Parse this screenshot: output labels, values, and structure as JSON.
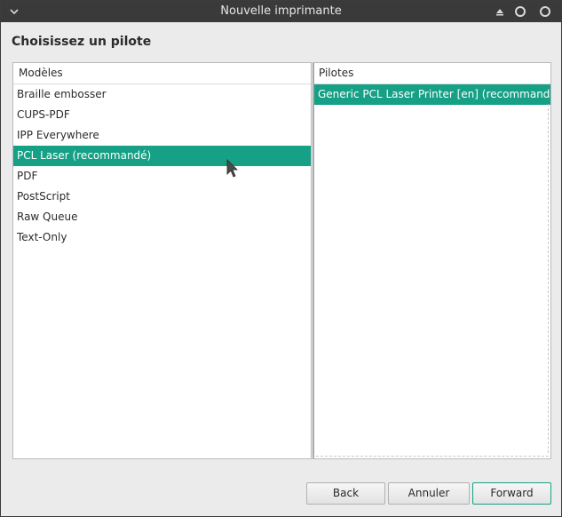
{
  "window": {
    "title": "Nouvelle imprimante"
  },
  "page": {
    "heading": "Choisissez un pilote"
  },
  "models": {
    "header": "Modèles",
    "items": [
      {
        "label": "Braille embosser",
        "selected": false
      },
      {
        "label": "CUPS-PDF",
        "selected": false
      },
      {
        "label": "IPP Everywhere",
        "selected": false
      },
      {
        "label": "PCL Laser (recommandé)",
        "selected": true
      },
      {
        "label": "PDF",
        "selected": false
      },
      {
        "label": "PostScript",
        "selected": false
      },
      {
        "label": "Raw Queue",
        "selected": false
      },
      {
        "label": "Text-Only",
        "selected": false
      }
    ]
  },
  "drivers": {
    "header": "Pilotes",
    "items": [
      {
        "label": "Generic PCL Laser Printer [en] (recommandé)",
        "selected": true
      }
    ]
  },
  "buttons": {
    "back": "Back",
    "cancel": "Annuler",
    "forward": "Forward"
  },
  "colors": {
    "accent": "#16a085",
    "titlebar": "#3a3a3a",
    "background": "#ebebeb"
  }
}
